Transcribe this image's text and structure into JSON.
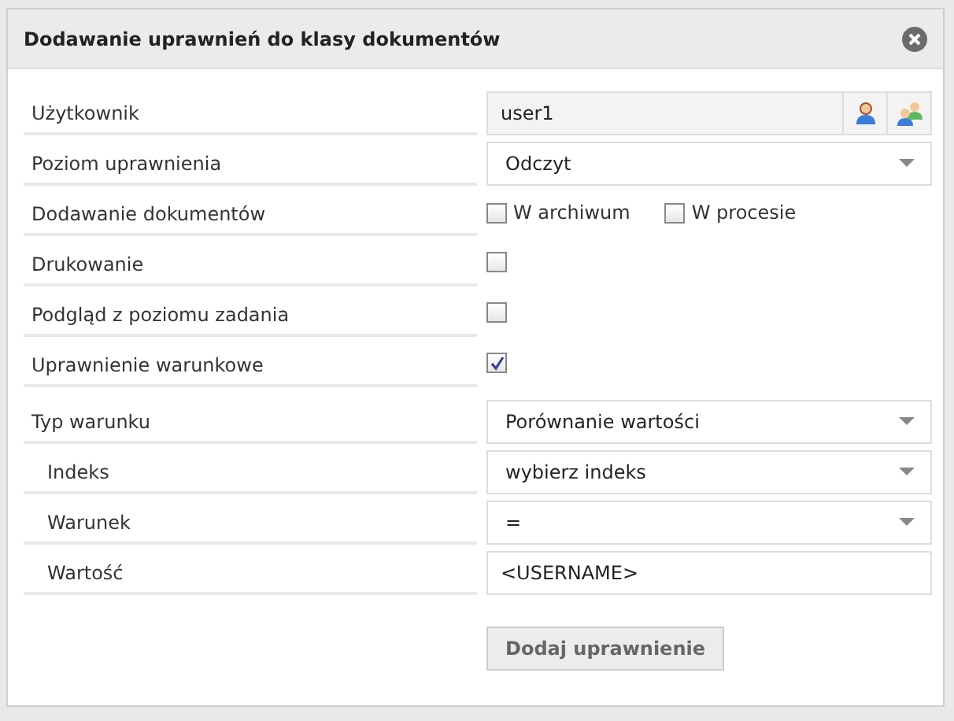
{
  "dialog": {
    "title": "Dodawanie uprawnień do klasy dokumentów"
  },
  "permission_rows": [
    {
      "label": "Użytkownik",
      "kind": "user",
      "value": "user1"
    },
    {
      "label": "Poziom uprawnienia",
      "kind": "select",
      "value": "Odczyt"
    },
    {
      "label": "Dodawanie dokumentów",
      "kind": "checks",
      "options": [
        {
          "label": "W archiwum",
          "checked": false
        },
        {
          "label": "W procesie",
          "checked": false
        }
      ]
    },
    {
      "label": "Drukowanie",
      "kind": "check",
      "checked": false
    },
    {
      "label": "Podgląd z poziomu zadania",
      "kind": "check",
      "checked": false
    },
    {
      "label": "Uprawnienie warunkowe",
      "kind": "check",
      "checked": true
    }
  ],
  "condition": {
    "label": "Typ warunku",
    "kind": "select",
    "value": "Porównanie wartości",
    "children": [
      {
        "label": "Indeks",
        "kind": "select",
        "value": "wybierz indeks"
      },
      {
        "label": "Warunek",
        "kind": "select",
        "value": "="
      },
      {
        "label": "Wartość",
        "kind": "text",
        "value": "<USERNAME>"
      }
    ]
  },
  "submit_button": "Dodaj uprawnienie"
}
